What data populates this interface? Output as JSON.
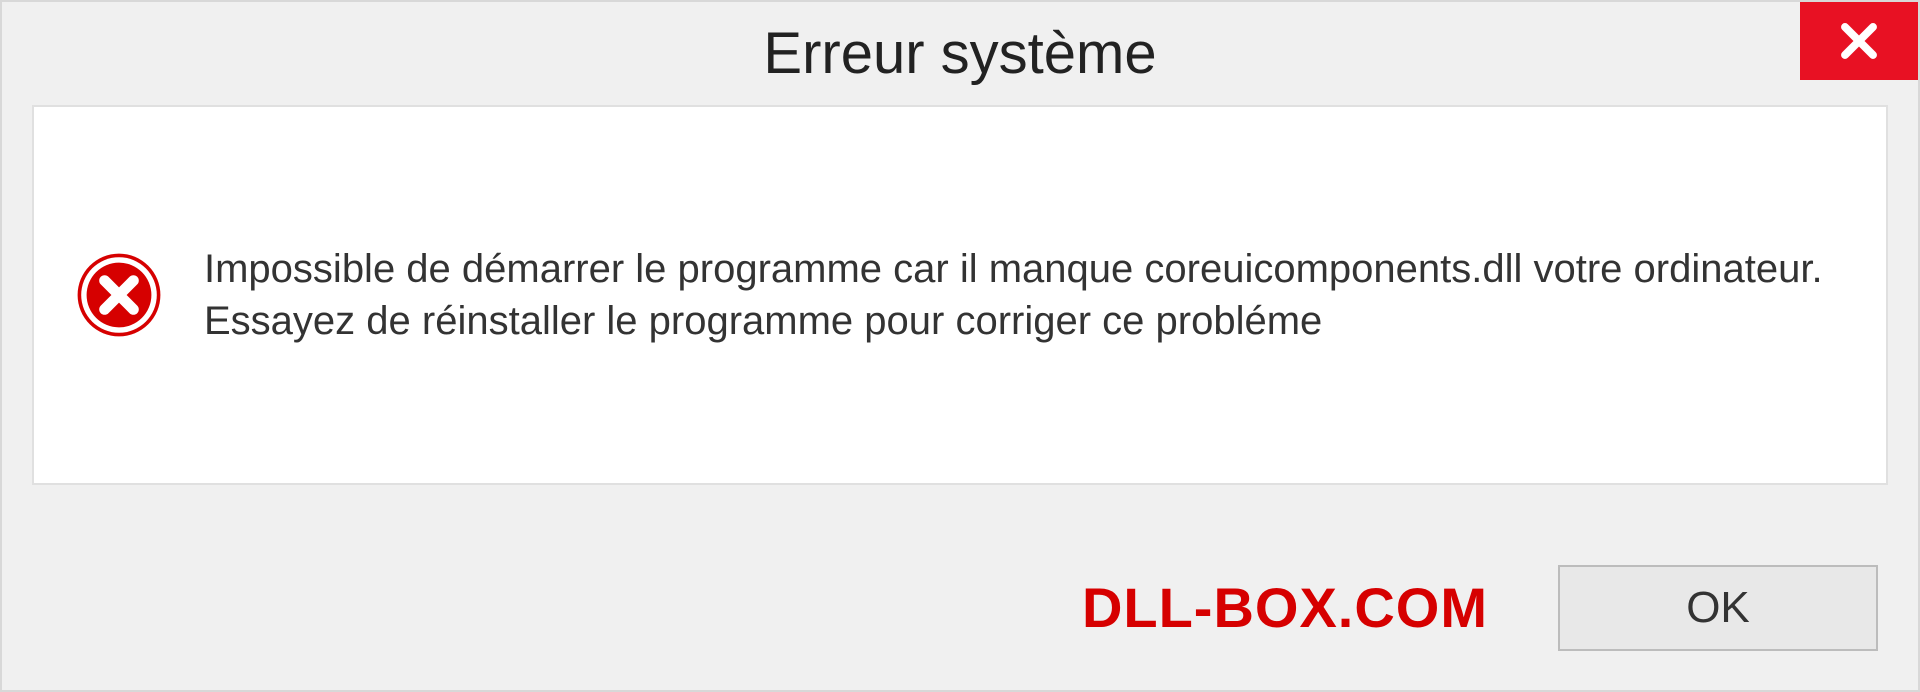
{
  "dialog": {
    "title": "Erreur système",
    "message": "Impossible de démarrer le programme car il manque coreuicomponents.dll votre ordinateur. Essayez de réinstaller le programme pour corriger ce probléme",
    "brand": "DLL-BOX.COM",
    "ok_label": "OK"
  }
}
